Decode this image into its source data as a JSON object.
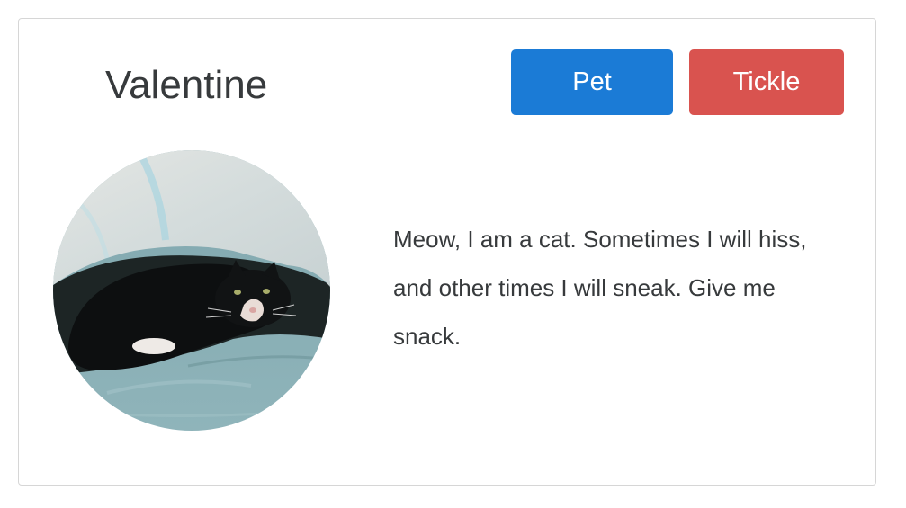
{
  "card": {
    "name": "Valentine",
    "buttons": {
      "pet_label": "Pet",
      "tickle_label": "Tickle"
    },
    "bio": "Meow, I am a cat. Sometimes I will hiss, and other times I will sneak. Give me snack."
  },
  "colors": {
    "pet_button": "#1b7bd6",
    "tickle_button": "#d9534f",
    "text": "#373a3c",
    "card_border": "#d6d6d6"
  },
  "avatar": {
    "subject": "black-and-white cat under a blanket"
  }
}
